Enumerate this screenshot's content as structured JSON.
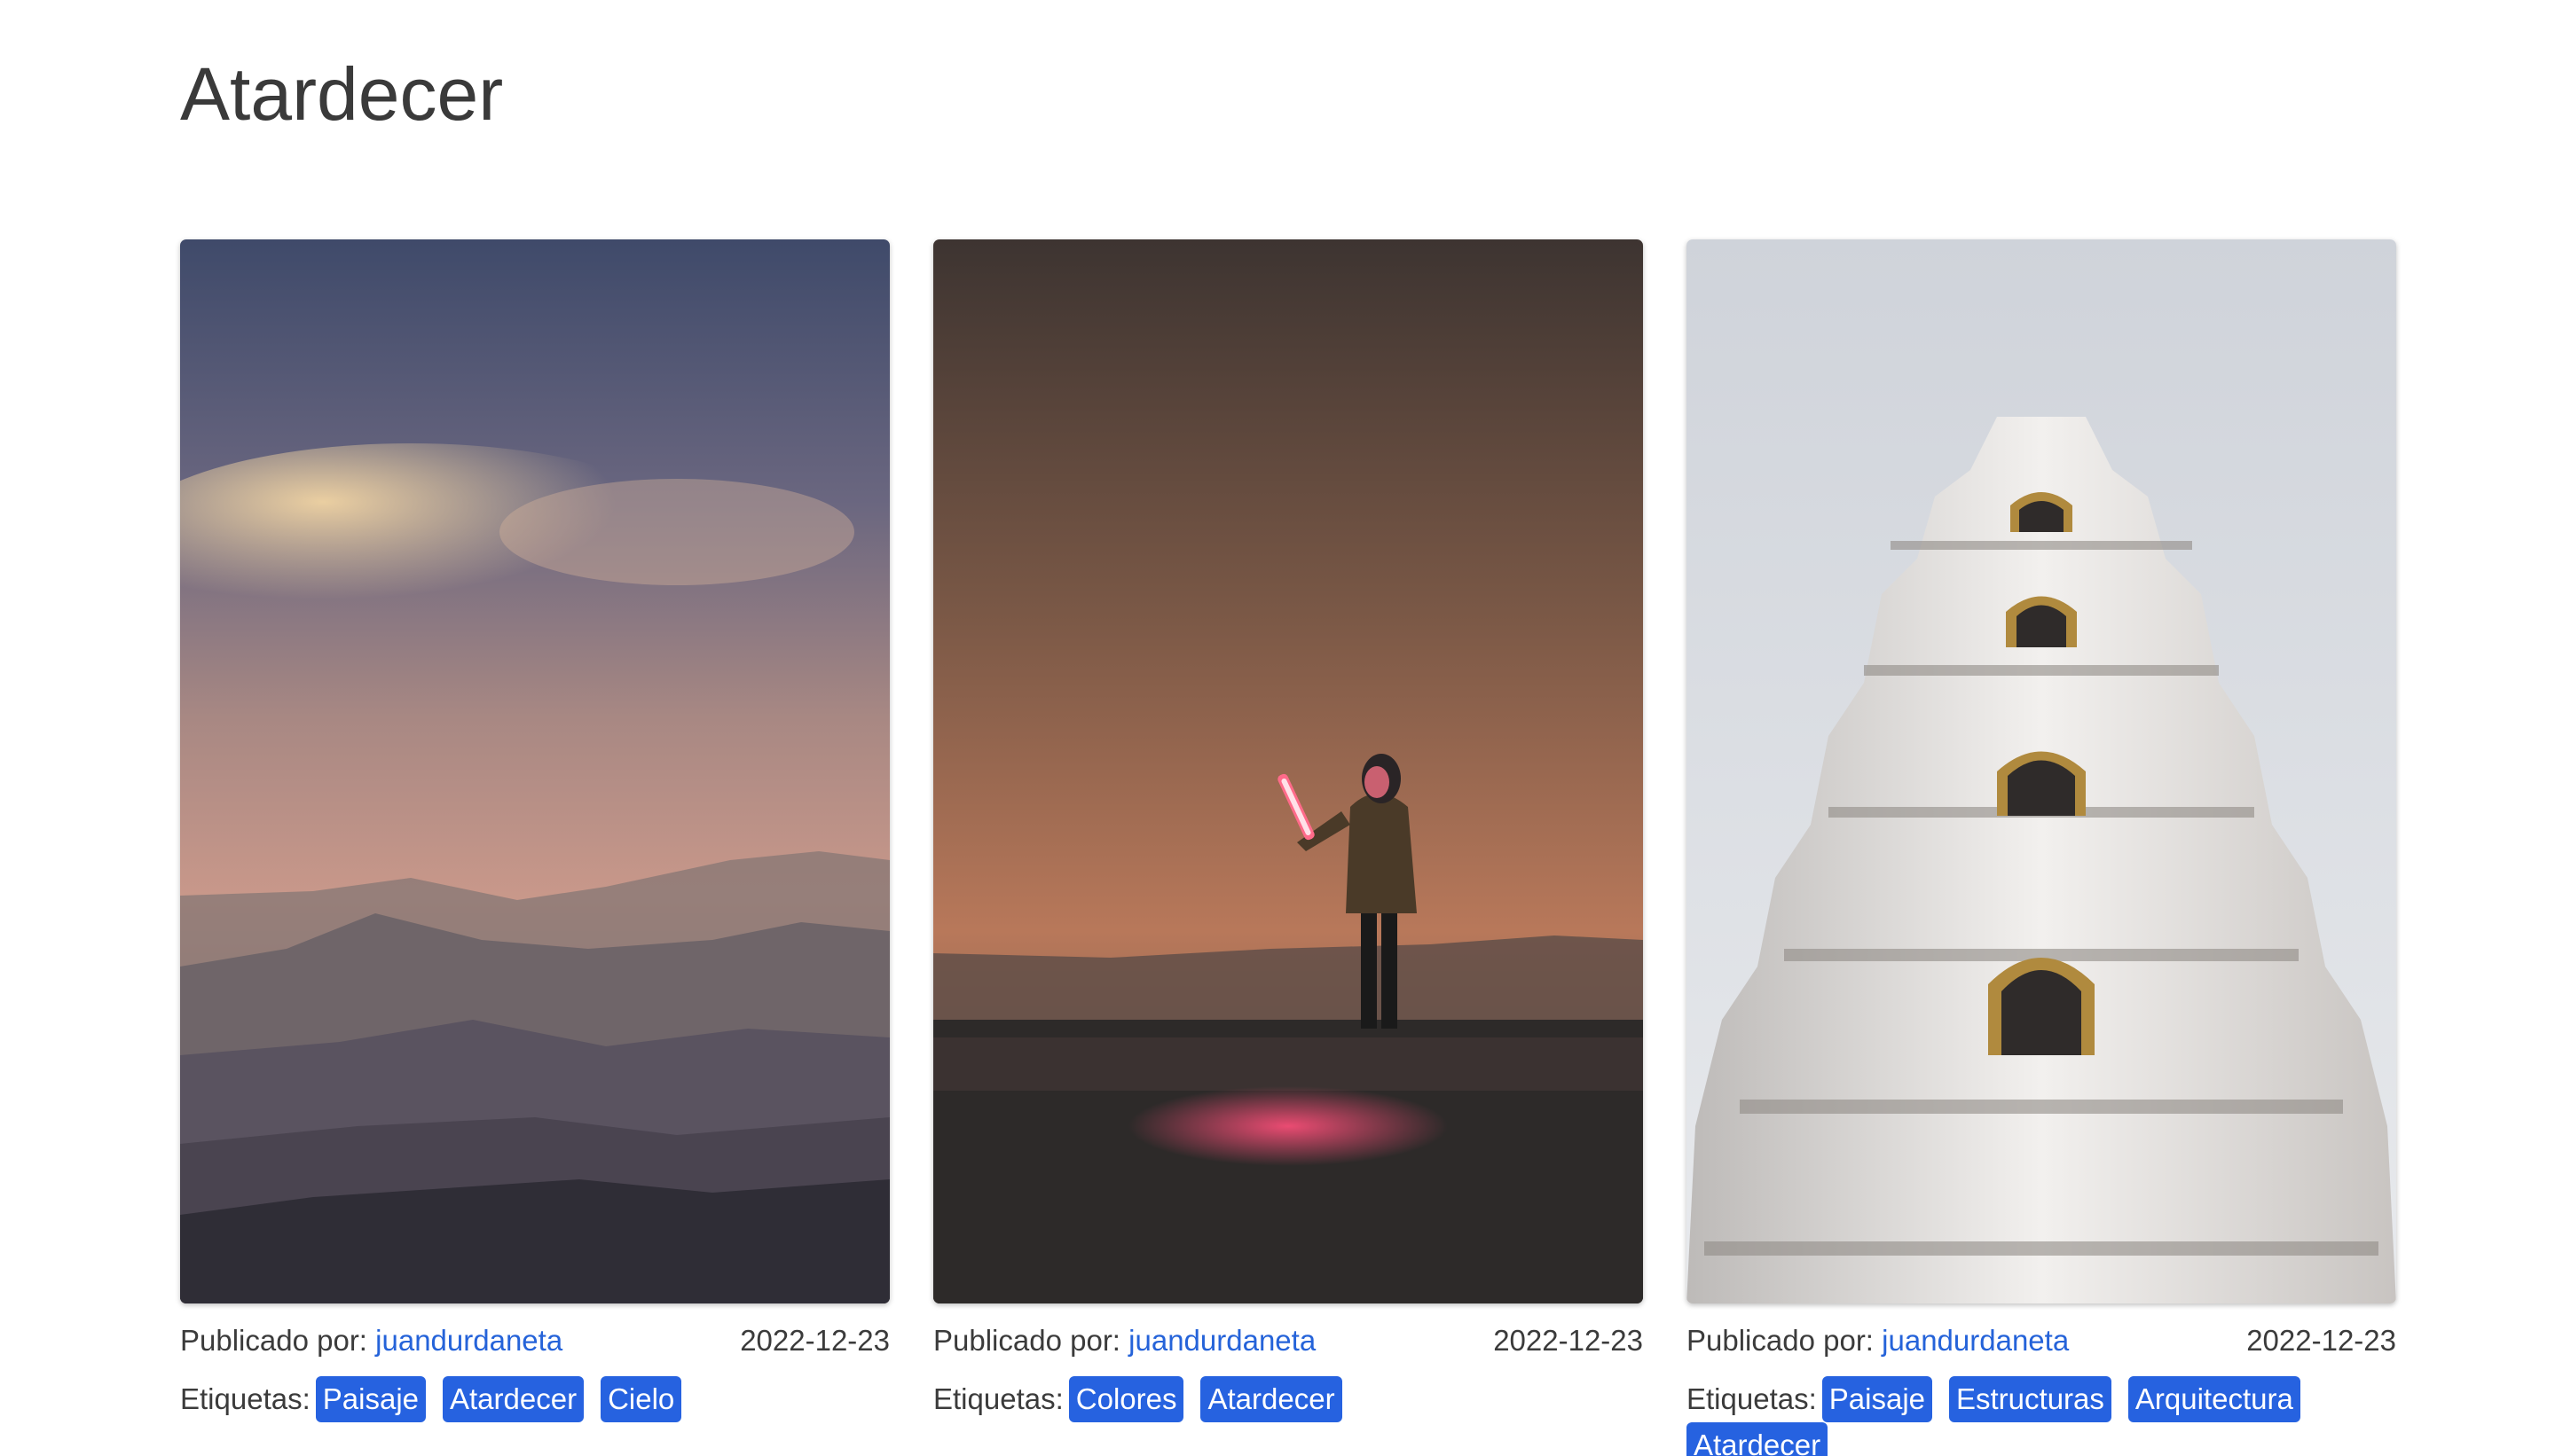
{
  "page": {
    "title": "Atardecer"
  },
  "labels": {
    "published_by": "Publicado por:",
    "tags": "Etiquetas:"
  },
  "cards": [
    {
      "photo_icon": "mountain-sunset-photo",
      "author": "juandurdaneta",
      "date": "2022-12-23",
      "tags": [
        "Paisaje",
        "Atardecer",
        "Cielo"
      ]
    },
    {
      "photo_icon": "person-with-light-photo",
      "author": "juandurdaneta",
      "date": "2022-12-23",
      "tags": [
        "Colores",
        "Atardecer"
      ]
    },
    {
      "photo_icon": "white-pagoda-photo",
      "author": "juandurdaneta",
      "date": "2022-12-23",
      "tags": [
        "Paisaje",
        "Estructuras",
        "Arquitectura",
        "Atardecer"
      ]
    }
  ],
  "colors": {
    "link": "#2563d9",
    "tag_bg": "#2662e0",
    "tag_text": "#ffffff"
  }
}
